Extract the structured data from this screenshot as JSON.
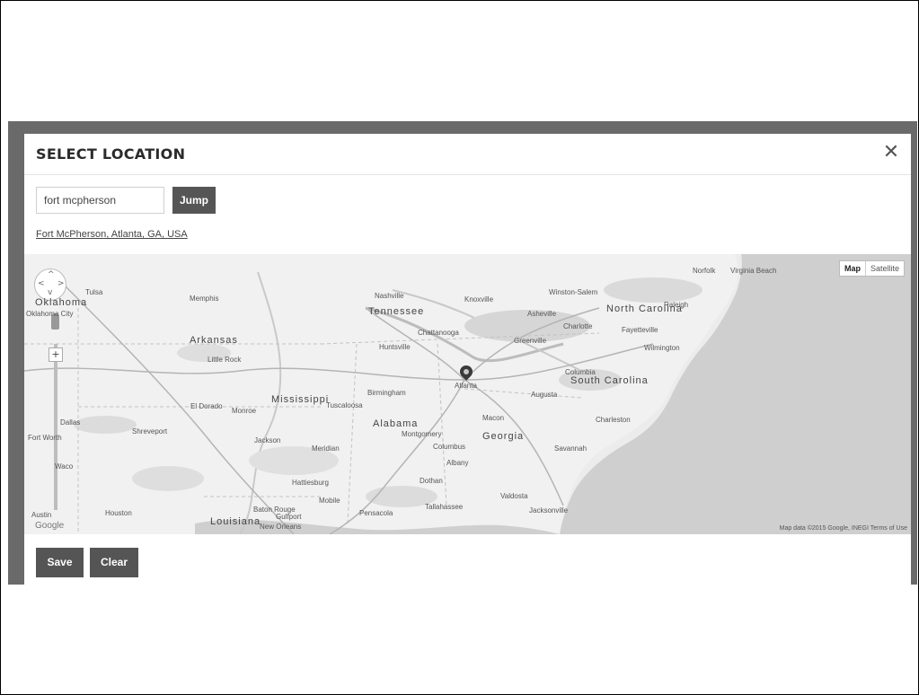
{
  "dialog": {
    "title": "SELECT LOCATION",
    "close_icon": "close-icon"
  },
  "search": {
    "value": "fort mcpherson",
    "jump_label": "Jump",
    "result_link": "Fort McPherson, Atlanta, GA, USA"
  },
  "map": {
    "type_map": "Map",
    "type_satellite": "Satellite",
    "attribution": "Map data ©2015 Google, INEGI   Terms of Use",
    "google_logo": "Google",
    "states": [
      "Oklahoma",
      "Arkansas",
      "Mississippi",
      "Alabama",
      "Georgia",
      "Tennessee",
      "North Carolina",
      "South Carolina",
      "Louisiana"
    ],
    "cities": [
      "Tulsa",
      "Oklahoma City",
      "Little Rock",
      "Nashville",
      "Knoxville",
      "Chattanooga",
      "Huntsville",
      "Birmingham",
      "Montgomery",
      "Atlanta",
      "Augusta",
      "Macon",
      "Columbus",
      "Savannah",
      "Charleston",
      "Charlotte",
      "Greenville",
      "Columbia",
      "Raleigh",
      "Winston-Salem",
      "Jackson",
      "Shreveport",
      "Dallas",
      "Fort Worth",
      "Waco",
      "Austin",
      "Houston",
      "Baton Rouge",
      "New Orleans",
      "Mobile",
      "Tallahassee",
      "Jacksonville",
      "Memphis",
      "Norfolk",
      "Virginia Beach",
      "Albany",
      "Dothan",
      "Valdosta",
      "Wilmington",
      "Fayetteville",
      "Asheville",
      "El Dorado",
      "Monroe",
      "Meridian",
      "Tuscaloosa",
      "Hattiesburg",
      "Pensacola",
      "Gulfport"
    ],
    "marker_icon": "map-pin-icon"
  },
  "footer": {
    "save_label": "Save",
    "clear_label": "Clear"
  }
}
